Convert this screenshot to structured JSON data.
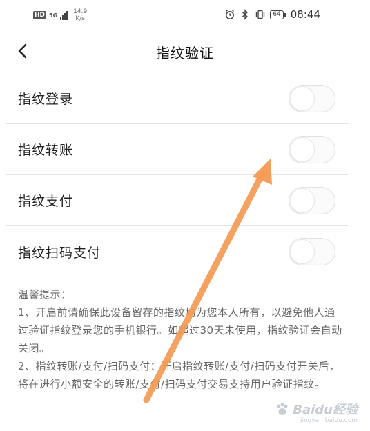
{
  "status_bar": {
    "network_badge": "HD",
    "network_type": "5G",
    "speed_value": "14.9",
    "speed_unit": "K/s",
    "battery_level": "64",
    "time": "08:44",
    "icons": [
      "alarm-icon",
      "bluetooth-icon",
      "vibrate-icon",
      "battery-icon"
    ]
  },
  "header": {
    "title": "指纹验证",
    "back_icon": "chevron-left-icon"
  },
  "settings": [
    {
      "label": "指纹登录",
      "enabled": false
    },
    {
      "label": "指纹转账",
      "enabled": false
    },
    {
      "label": "指纹支付",
      "enabled": false
    },
    {
      "label": "指纹扫码支付",
      "enabled": false
    }
  ],
  "tips": {
    "title": "温馨提示：",
    "line1": "1、开启前请确保此设备留存的指纹均为您本人所有，以避免他人通过验证指纹登录您的手机银行。如超过30天未使用，指纹验证会自动关闭。",
    "line2": "2、指纹转账/支付/扫码支付：开启指纹转账/支付/扫码支付开关后，将在进行小额安全的转账/支付/扫码支付交易支持用户验证指纹。"
  },
  "watermark": {
    "text": "Baidu经验",
    "sub": "jingyan.baidu.com"
  },
  "colors": {
    "arrow": "#f59a53",
    "divider": "#e4e4e4",
    "tip_text": "#666666"
  }
}
